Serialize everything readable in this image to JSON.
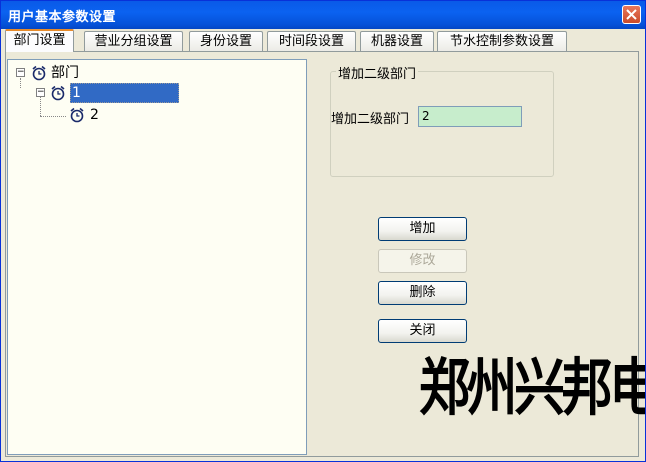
{
  "window": {
    "title": "用户基本参数设置"
  },
  "tabs": [
    {
      "label": "部门设置",
      "active": true
    },
    {
      "label": "营业分组设置"
    },
    {
      "label": "身份设置"
    },
    {
      "label": "时间段设置"
    },
    {
      "label": "机器设置"
    },
    {
      "label": "节水控制参数设置"
    }
  ],
  "tree": {
    "root": {
      "label": "部门",
      "expander": "⊟",
      "icon": "alarm-clock-icon"
    },
    "child": {
      "label": "1",
      "expander": "⊟",
      "icon": "alarm-clock-icon",
      "selected": true
    },
    "grandchild": {
      "label": "2",
      "icon": "alarm-clock-icon"
    }
  },
  "group": {
    "legend": "增加二级部门",
    "field_label": "增加二级部门",
    "field_value": "2"
  },
  "buttons": {
    "add": "增加",
    "edit": "修改",
    "delete": "删除",
    "close": "关闭"
  },
  "watermark": "郑州兴邦电子",
  "colors": {
    "title_bar": "#0a5ae8",
    "selection": "#316ac5",
    "input_bg": "#c7edcc",
    "active_tab_accent": "#e68b2c"
  }
}
